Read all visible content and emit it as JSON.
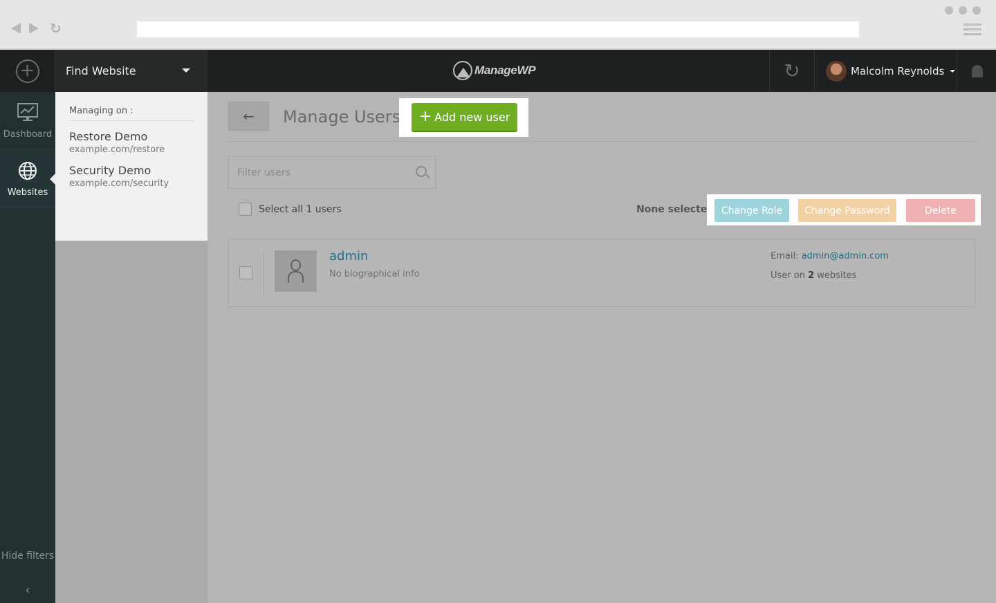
{
  "topbar": {
    "find_website": "Find Website",
    "logo_text": "ManageWP",
    "user_name": "Malcolm Reynolds"
  },
  "leftnav": {
    "items": [
      {
        "label": "Dashboard",
        "icon": "dashboard-icon"
      },
      {
        "label": "Websites",
        "icon": "globe-icon"
      }
    ],
    "hide_filters": "Hide filters"
  },
  "filterpanel": {
    "managing_label": "Managing on :",
    "sites": [
      {
        "name": "Restore Demo",
        "url": "example.com/restore"
      },
      {
        "name": "Security Demo",
        "url": "example.com/security"
      }
    ]
  },
  "main": {
    "title": "Manage Users",
    "add_user_label": "Add new user",
    "filter_placeholder": "Filter users",
    "select_all_label": "Select all 1 users",
    "none_selected": "None selected",
    "actions": {
      "change_role": "Change Role",
      "change_password": "Change Password",
      "delete": "Delete"
    },
    "users": [
      {
        "username": "admin",
        "bio": "No biographical info",
        "email_label": "Email:",
        "email": "admin@admin.com",
        "user_on_prefix": "User on",
        "sites_count": "2",
        "user_on_suffix": "websites"
      }
    ]
  },
  "colors": {
    "add_button": "#6fae22",
    "change_role": "#9dd3dd",
    "change_password": "#f3d0a3",
    "delete": "#eeb0b0",
    "link": "#1c6f86"
  }
}
